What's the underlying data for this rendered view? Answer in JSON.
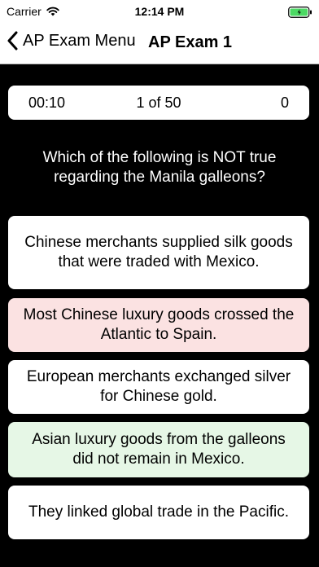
{
  "status_bar": {
    "carrier": "Carrier",
    "time": "12:14 PM",
    "battery_color": "#4cd964"
  },
  "nav": {
    "back_label": "AP Exam Menu",
    "title": "AP Exam 1"
  },
  "stats": {
    "timer": "00:10",
    "progress": "1 of 50",
    "score": "0"
  },
  "question": {
    "text": "Which of the following is NOT true regarding the Manila galleons?"
  },
  "answers": [
    {
      "text": "Chinese merchants supplied silk goods that were traded with Mexico.",
      "state": "neutral"
    },
    {
      "text": "Most Chinese luxury goods crossed the Atlantic to Spain.",
      "state": "incorrect"
    },
    {
      "text": "European merchants exchanged silver for Chinese gold.",
      "state": "neutral"
    },
    {
      "text": "Asian luxury goods from the galleons did not remain in Mexico.",
      "state": "correct"
    },
    {
      "text": "They linked global trade in the Pacific.",
      "state": "neutral"
    }
  ],
  "colors": {
    "background": "#000000",
    "incorrect_highlight": "#fbe2e2",
    "correct_highlight": "#e6f7e6"
  }
}
